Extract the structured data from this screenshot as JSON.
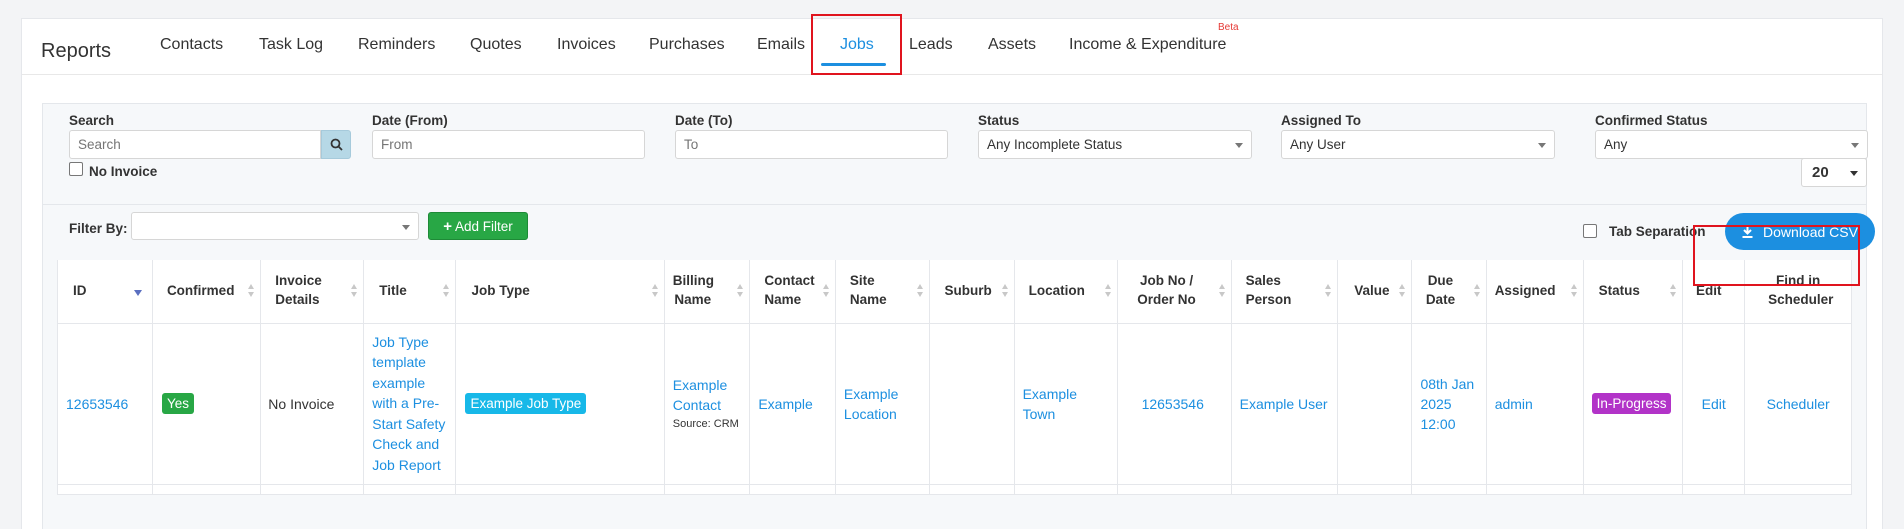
{
  "brand": "Reports",
  "tabs": [
    {
      "label": "Contacts"
    },
    {
      "label": "Task Log"
    },
    {
      "label": "Reminders"
    },
    {
      "label": "Quotes"
    },
    {
      "label": "Invoices"
    },
    {
      "label": "Purchases"
    },
    {
      "label": "Emails"
    },
    {
      "label": "Jobs",
      "active": true
    },
    {
      "label": "Leads"
    },
    {
      "label": "Assets"
    },
    {
      "label": "Income & Expenditure"
    }
  ],
  "beta_label": "Beta",
  "filters": {
    "search": {
      "label": "Search",
      "placeholder": "Search"
    },
    "date_from": {
      "label": "Date (From)",
      "placeholder": "From"
    },
    "date_to": {
      "label": "Date (To)",
      "placeholder": "To"
    },
    "status": {
      "label": "Status",
      "value": "Any Incomplete Status"
    },
    "assigned_to": {
      "label": "Assigned To",
      "value": "Any User"
    },
    "confirmed_status": {
      "label": "Confirmed Status",
      "value": "Any"
    },
    "no_invoice_label": "No Invoice",
    "page_size": "20"
  },
  "filter_bar": {
    "filter_by_label": "Filter By:",
    "add_filter_label": "Add Filter",
    "tab_separation_label": "Tab Separation",
    "download_csv_label": "Download CSV"
  },
  "table": {
    "columns": [
      "ID",
      "Confirmed",
      "Invoice Details",
      "Title",
      "Job Type",
      "Billing Name",
      "Contact Name",
      "Site Name",
      "Suburb",
      "Location",
      "Job No / Order No",
      "Sales Person",
      "Value",
      "Due Date",
      "Assigned",
      "Status",
      "Edit",
      "Find in Scheduler"
    ],
    "rows": [
      {
        "id": "12653546",
        "confirmed": "Yes",
        "invoice_details": "No Invoice",
        "title": "Job Type template example with a Pre-Start Safety Check and Job Report",
        "job_type": "Example Job Type",
        "billing_name": "Example Contact",
        "billing_source": "Source: CRM",
        "contact_name": "Example",
        "site_name": "Example Location",
        "suburb": "",
        "location": "Example Town",
        "job_no": "12653546",
        "sales_person": "Example User",
        "value": "",
        "due_date": "08th Jan 2025 12:00",
        "assigned": "admin",
        "status": "In-Progress",
        "edit": "Edit",
        "scheduler": "Scheduler"
      }
    ]
  },
  "colors": {
    "accent": "#1c8fe0",
    "confirmed_badge": "#28a745",
    "job_type_badge": "#17b8e8",
    "status_badge": "#b233c8",
    "highlight_box": "#e0141e",
    "add_filter": "#28a745"
  }
}
